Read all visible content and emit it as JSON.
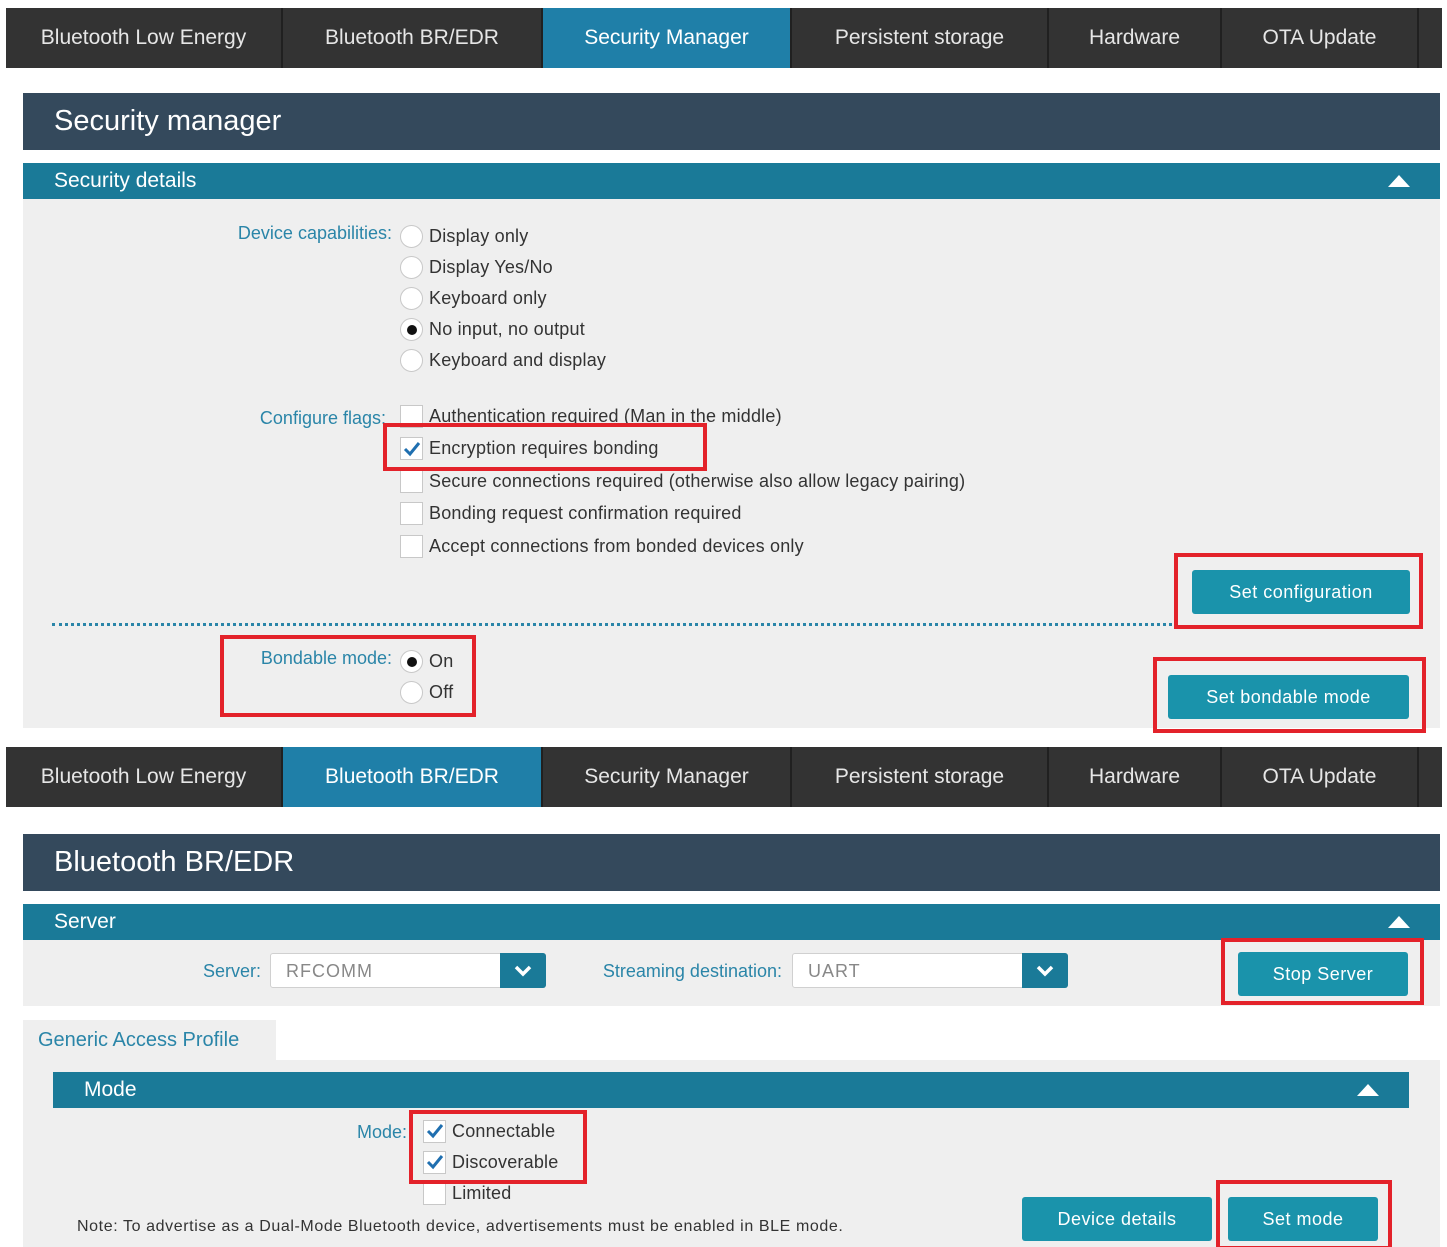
{
  "nav": [
    "Bluetooth Low Energy",
    "Bluetooth BR/EDR",
    "Security Manager",
    "Persistent storage",
    "Hardware",
    "OTA Update"
  ],
  "security": {
    "title": "Security manager",
    "section": "Security details",
    "device_capabilities_label": "Device capabilities:",
    "capabilities": [
      {
        "label": "Display only",
        "selected": false
      },
      {
        "label": "Display Yes/No",
        "selected": false
      },
      {
        "label": "Keyboard only",
        "selected": false
      },
      {
        "label": "No input, no output",
        "selected": true
      },
      {
        "label": "Keyboard and display",
        "selected": false
      }
    ],
    "configure_flags_label": "Configure flags:",
    "flags": [
      {
        "label": "Authentication required (Man in the middle)",
        "checked": false
      },
      {
        "label": "Encryption requires bonding",
        "checked": true
      },
      {
        "label": "Secure connections required (otherwise also allow legacy pairing)",
        "checked": false
      },
      {
        "label": "Bonding request confirmation required",
        "checked": false
      },
      {
        "label": "Accept connections from bonded devices only",
        "checked": false
      }
    ],
    "set_configuration": "Set configuration",
    "bondable_label": "Bondable mode:",
    "bondable": [
      {
        "label": "On",
        "selected": true
      },
      {
        "label": "Off",
        "selected": false
      }
    ],
    "set_bondable": "Set bondable mode"
  },
  "bredr": {
    "title": "Bluetooth BR/EDR",
    "server_section": "Server",
    "server_label": "Server:",
    "server_value": "RFCOMM",
    "streaming_label": "Streaming destination:",
    "streaming_value": "UART",
    "stop_server": "Stop Server",
    "gap_tab": "Generic Access Profile",
    "mode_section": "Mode",
    "mode_label": "Mode:",
    "modes": [
      {
        "label": "Connectable",
        "checked": true
      },
      {
        "label": "Discoverable",
        "checked": true
      },
      {
        "label": "Limited",
        "checked": false
      }
    ],
    "note": "Note: To advertise as a Dual-Mode Bluetooth device, advertisements must be enabled in BLE mode.",
    "device_details": "Device details",
    "set_mode": "Set mode"
  },
  "colors": {
    "accent": "#1a7a98",
    "button": "#1a93ab",
    "highlight": "#e3222a",
    "nav_active": "#1f7fa8"
  }
}
